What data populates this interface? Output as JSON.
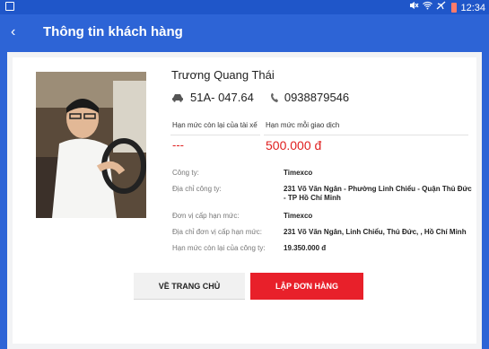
{
  "status_bar": {
    "time": "12:34",
    "icons": [
      "mute-icon",
      "wifi-icon",
      "airplane-icon",
      "battery-icon"
    ]
  },
  "header": {
    "title": "Thông tin khách hàng",
    "back_icon": "‹"
  },
  "driver": {
    "name": "Trương Quang Thái",
    "plate": "51A- 047.64",
    "phone": "0938879546"
  },
  "limits": {
    "remaining_label": "Hạn mức còn lại của tài xế",
    "remaining_value": "---",
    "per_transaction_label": "Hạn mức mỗi giao dịch",
    "per_transaction_value": "500.000 đ"
  },
  "info": [
    {
      "label": "Công ty:",
      "value": "Timexco"
    },
    {
      "label": "Địa chỉ công ty:",
      "value": "231 Võ Văn Ngân - Phường Linh Chiểu - Quận Thủ Đức - TP Hồ Chí Minh"
    },
    {
      "label": "Đơn vị cấp hạn mức:",
      "value": "Timexco"
    },
    {
      "label": "Địa chỉ đơn vị cấp hạn mức:",
      "value": "231 Võ Văn Ngân, Linh Chiểu, Thủ Đức, , Hồ Chí Minh"
    },
    {
      "label": "Hạn mức còn lại của công ty:",
      "value": "19.350.000 đ"
    }
  ],
  "buttons": {
    "home": "VỀ TRANG CHỦ",
    "order": "LẬP ĐƠN HÀNG"
  },
  "colors": {
    "primary": "#2d64d6",
    "accent": "#e8202a",
    "value_red": "#e02020"
  }
}
